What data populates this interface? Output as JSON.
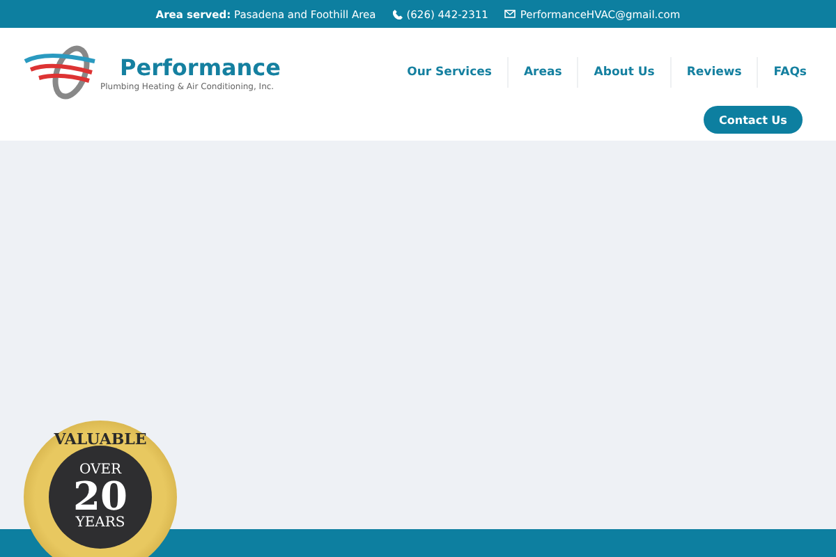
{
  "top_bar": {
    "area_label": "Area served:",
    "area_value": "Pasadena and Foothill Area",
    "phone": "(626) 442-2311",
    "email": "PerformanceHVAC@gmail.com"
  },
  "logo": {
    "name": "Performance",
    "tagline": "Plumbing Heating & Air Conditioning, Inc."
  },
  "nav": [
    {
      "label": "Our Services"
    },
    {
      "label": "Areas"
    },
    {
      "label": "About Us"
    },
    {
      "label": "Reviews"
    },
    {
      "label": "FAQs"
    }
  ],
  "contact_button": "Contact Us",
  "badge": {
    "top": "VALUABLE",
    "over": "OVER",
    "number": "20",
    "years": "YEARS"
  }
}
